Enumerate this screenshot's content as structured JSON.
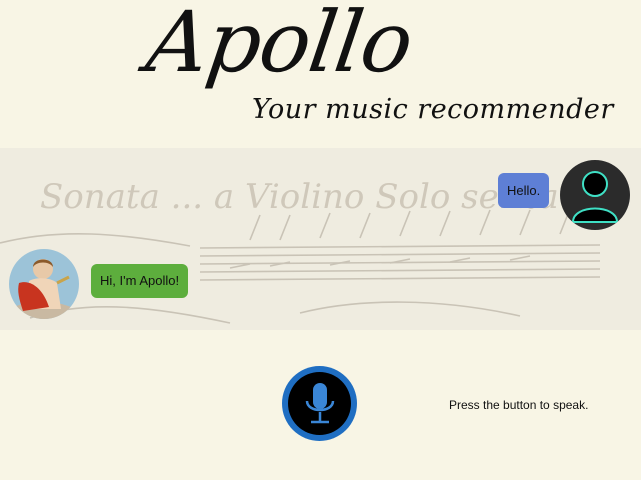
{
  "header": {
    "title": "Apollo",
    "subtitle": "Your music recommender"
  },
  "chat": {
    "messages": [
      {
        "sender": "user",
        "text": "Hello.",
        "avatar_icon": "user-silhouette-icon"
      },
      {
        "sender": "bot",
        "text": "Hi, I'm Apollo!",
        "avatar_icon": "apollo-avatar"
      }
    ],
    "background_text": "Sonata ... a Violino Solo senza ..."
  },
  "controls": {
    "mic_icon": "microphone-icon",
    "hint": "Press the button to speak."
  },
  "colors": {
    "page_bg": "#f8f5e5",
    "user_bubble": "#5e7fd5",
    "bot_bubble": "#5dae3d",
    "mic_ring": "#1f6ec2",
    "user_icon_accent": "#3fe0c5"
  }
}
